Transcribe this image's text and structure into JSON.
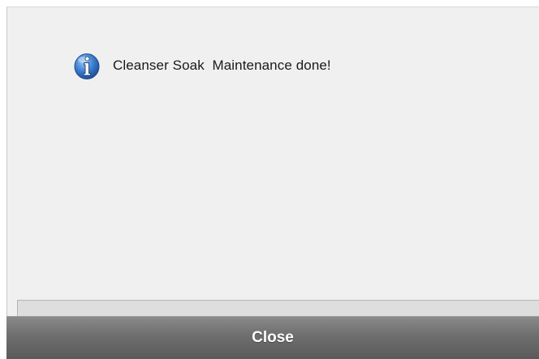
{
  "dialog": {
    "message": "Cleanser Soak  Maintenance done!",
    "icon": "info-icon",
    "close_label": "Close"
  },
  "colors": {
    "dialog_background": "#f0f0f0",
    "close_bar": "#6e6e6e",
    "close_text": "#ffffff",
    "info_icon_blue": "#2f6fc4"
  }
}
